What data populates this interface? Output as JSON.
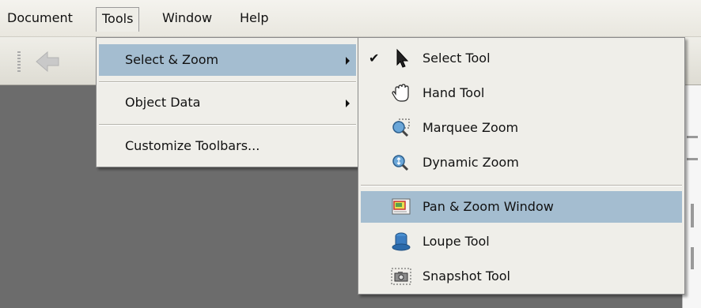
{
  "menubar": {
    "items": [
      {
        "label": "Document"
      },
      {
        "label": "Tools"
      },
      {
        "label": "Window"
      },
      {
        "label": "Help"
      }
    ]
  },
  "tools_menu": {
    "items": [
      {
        "label": "Select & Zoom",
        "has_submenu": true,
        "highlighted": true
      },
      {
        "label": "Object Data",
        "has_submenu": true
      },
      {
        "label": "Customize Toolbars..."
      }
    ]
  },
  "select_zoom_submenu": {
    "items": [
      {
        "label": "Select Tool",
        "checked": true,
        "icon": "arrow-pointer-icon"
      },
      {
        "label": "Hand Tool",
        "icon": "hand-icon"
      },
      {
        "label": "Marquee Zoom",
        "icon": "marquee-zoom-icon"
      },
      {
        "label": "Dynamic Zoom",
        "icon": "dynamic-zoom-icon"
      },
      {
        "label": "Pan & Zoom Window",
        "icon": "pan-zoom-window-icon",
        "highlighted": true
      },
      {
        "label": "Loupe Tool",
        "icon": "loupe-icon"
      },
      {
        "label": "Snapshot Tool",
        "icon": "camera-icon"
      }
    ]
  },
  "colors": {
    "highlight": "#a4bdd0",
    "menu_bg": "#efeee9",
    "doc_bg": "#6c6c6c"
  }
}
